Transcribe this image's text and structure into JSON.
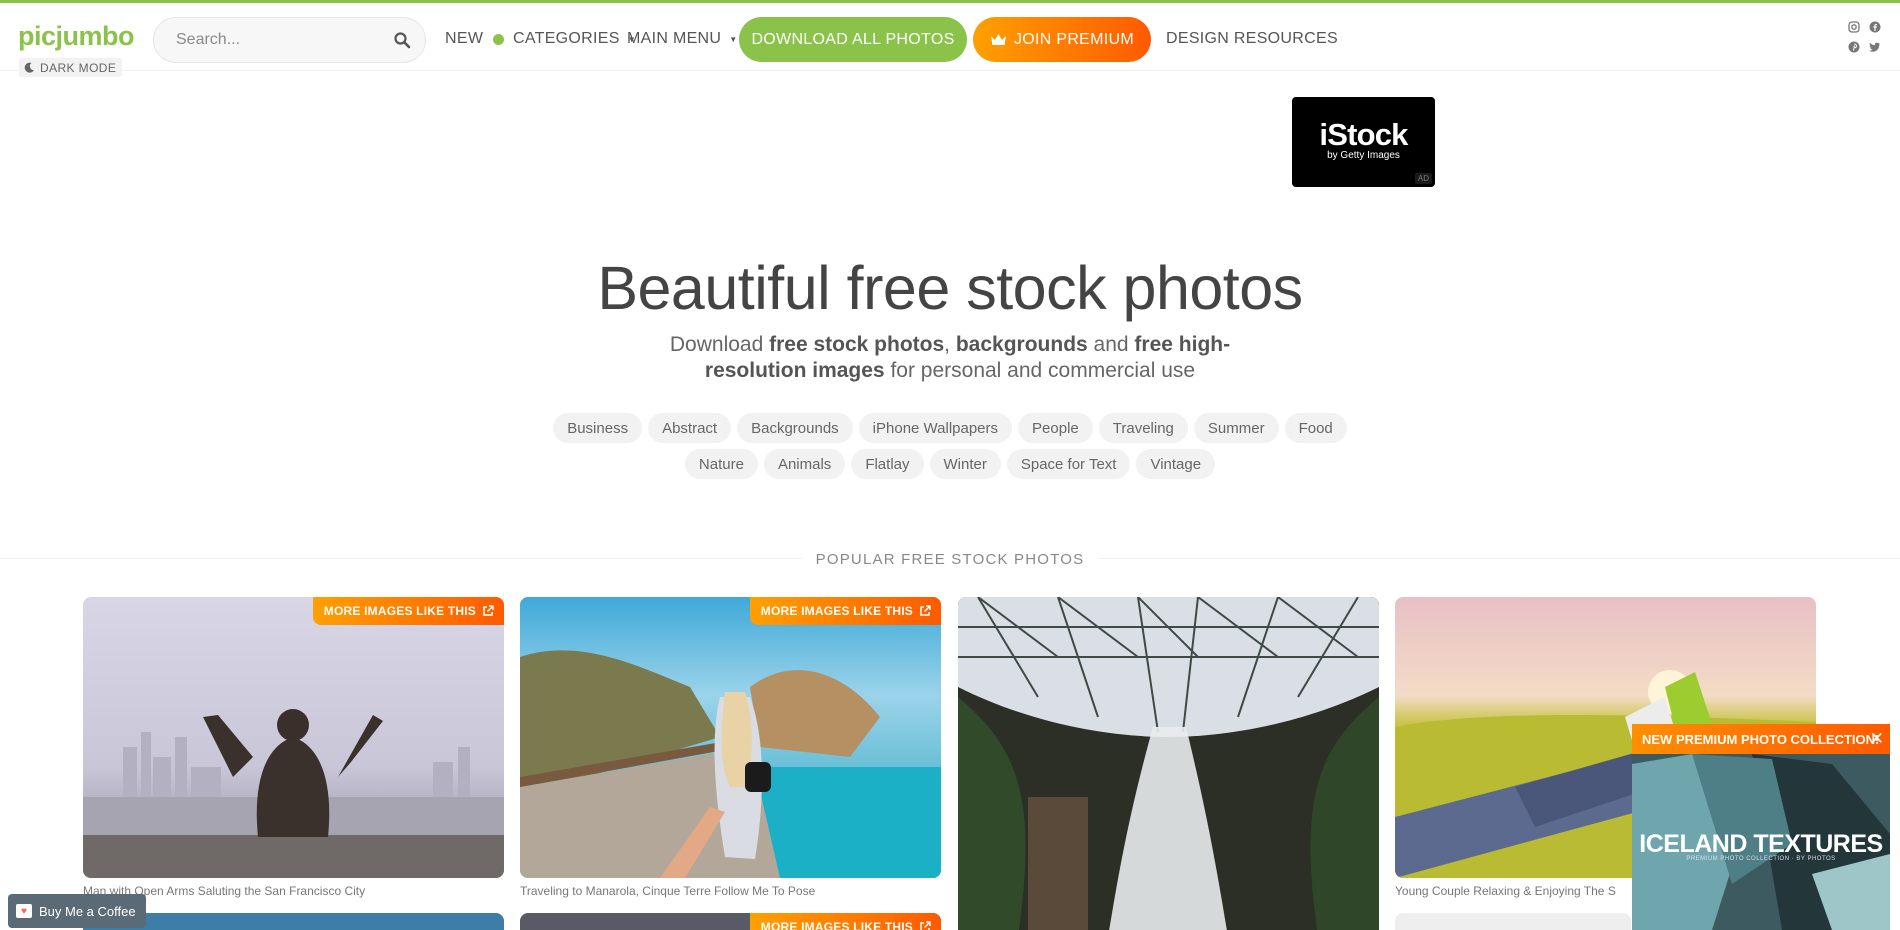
{
  "header": {
    "logo": "picjumbo",
    "dark_mode": "DARK MODE",
    "search_placeholder": "Search...",
    "nav": {
      "new": "NEW",
      "categories": "CATEGORIES",
      "main_menu": "MAIN MENU",
      "design_resources": "DESIGN RESOURCES"
    },
    "download_all": "DOWNLOAD ALL PHOTOS",
    "join_premium": "JOIN PREMIUM"
  },
  "ad": {
    "brand": "iStock",
    "tagline": "by Getty Images",
    "label": "AD"
  },
  "hero": {
    "title": "Beautiful free stock photos",
    "subtitle_parts": [
      "Download ",
      "free stock photos",
      ", ",
      "backgrounds",
      " and ",
      "free high-resolution images",
      " for personal and commercial use"
    ]
  },
  "tags": [
    "Business",
    "Abstract",
    "Backgrounds",
    "iPhone Wallpapers",
    "People",
    "Traveling",
    "Summer",
    "Food",
    "Nature",
    "Animals",
    "Flatlay",
    "Winter",
    "Space for Text",
    "Vintage"
  ],
  "section_title": "POPULAR FREE STOCK PHOTOS",
  "more_label": "MORE IMAGES LIKE THIS",
  "photos": [
    {
      "caption": "Man with Open Arms Saluting the San Francisco City"
    },
    {
      "caption": "Traveling to Manarola, Cinque Terre Follow Me To Pose"
    },
    {
      "caption": ""
    },
    {
      "caption": "Young Couple Relaxing & Enjoying The S"
    }
  ],
  "popup": {
    "header": "NEW PREMIUM PHOTO COLLECTION!",
    "close": "✕",
    "title": "ICELAND TEXTURES",
    "subtitle": "PREMIUM PHOTO COLLECTION · BY PHOTOS"
  },
  "coffee": {
    "label": "Buy Me a Coffee"
  },
  "colors": {
    "brand_green": "#8bc34a",
    "premium_orange": "#ff6a00"
  }
}
